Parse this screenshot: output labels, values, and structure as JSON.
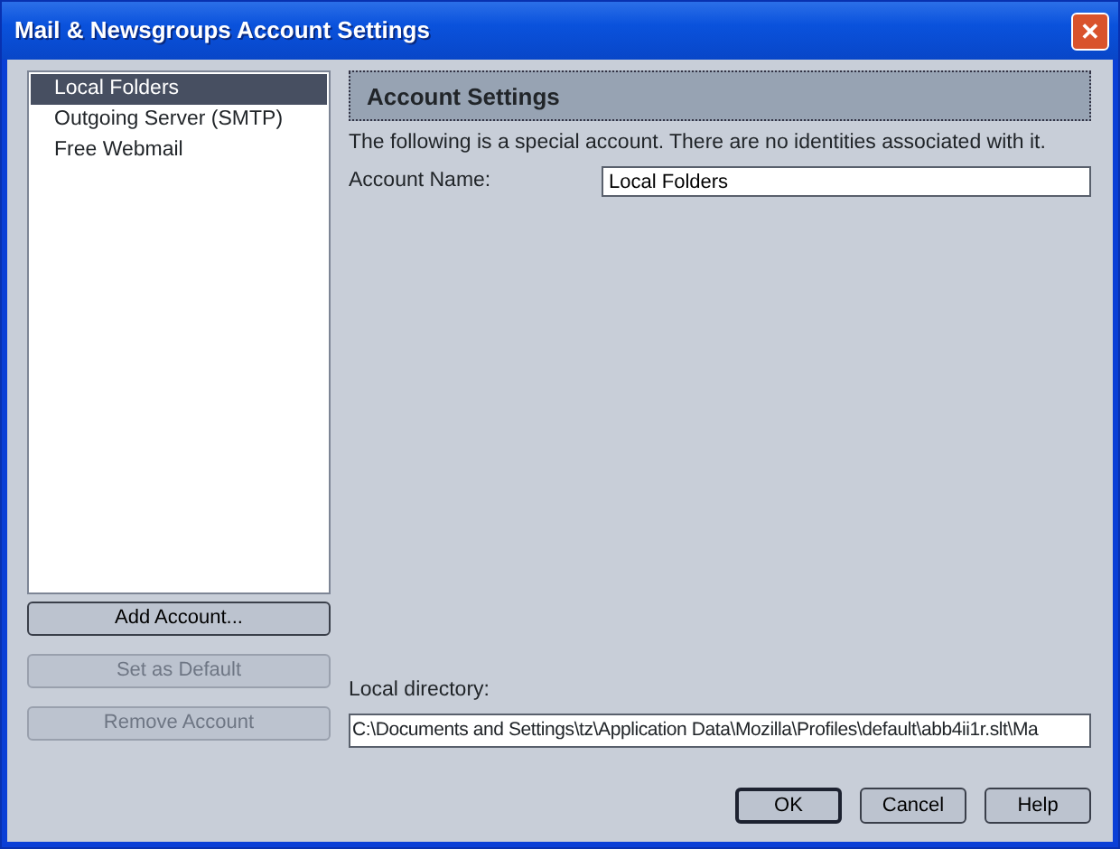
{
  "window": {
    "title": "Mail & Newsgroups Account Settings",
    "close": "✕"
  },
  "accounts": [
    {
      "label": "Local Folders",
      "selected": true
    },
    {
      "label": "Outgoing Server (SMTP)",
      "selected": false
    },
    {
      "label": "Free Webmail",
      "selected": false
    }
  ],
  "account_buttons": [
    {
      "label": "Add Account...",
      "disabled": false
    },
    {
      "label": "Set as Default",
      "disabled": true
    },
    {
      "label": "Remove Account",
      "disabled": true
    }
  ],
  "panel": {
    "heading": "Account Settings",
    "description": "The following is a special account. There are no identities associated with it.",
    "account_name_label": "Account Name:",
    "account_name": "Local Folders",
    "local_directory_label": "Local directory:",
    "local_directory": "C:\\Documents and Settings\\tz\\Application Data\\Mozilla\\Profiles\\default\\abb4ii1r.slt\\Ma"
  },
  "dialog_buttons": [
    {
      "label": "OK",
      "default": true
    },
    {
      "label": "Cancel",
      "default": false
    },
    {
      "label": "Help",
      "default": false
    }
  ]
}
